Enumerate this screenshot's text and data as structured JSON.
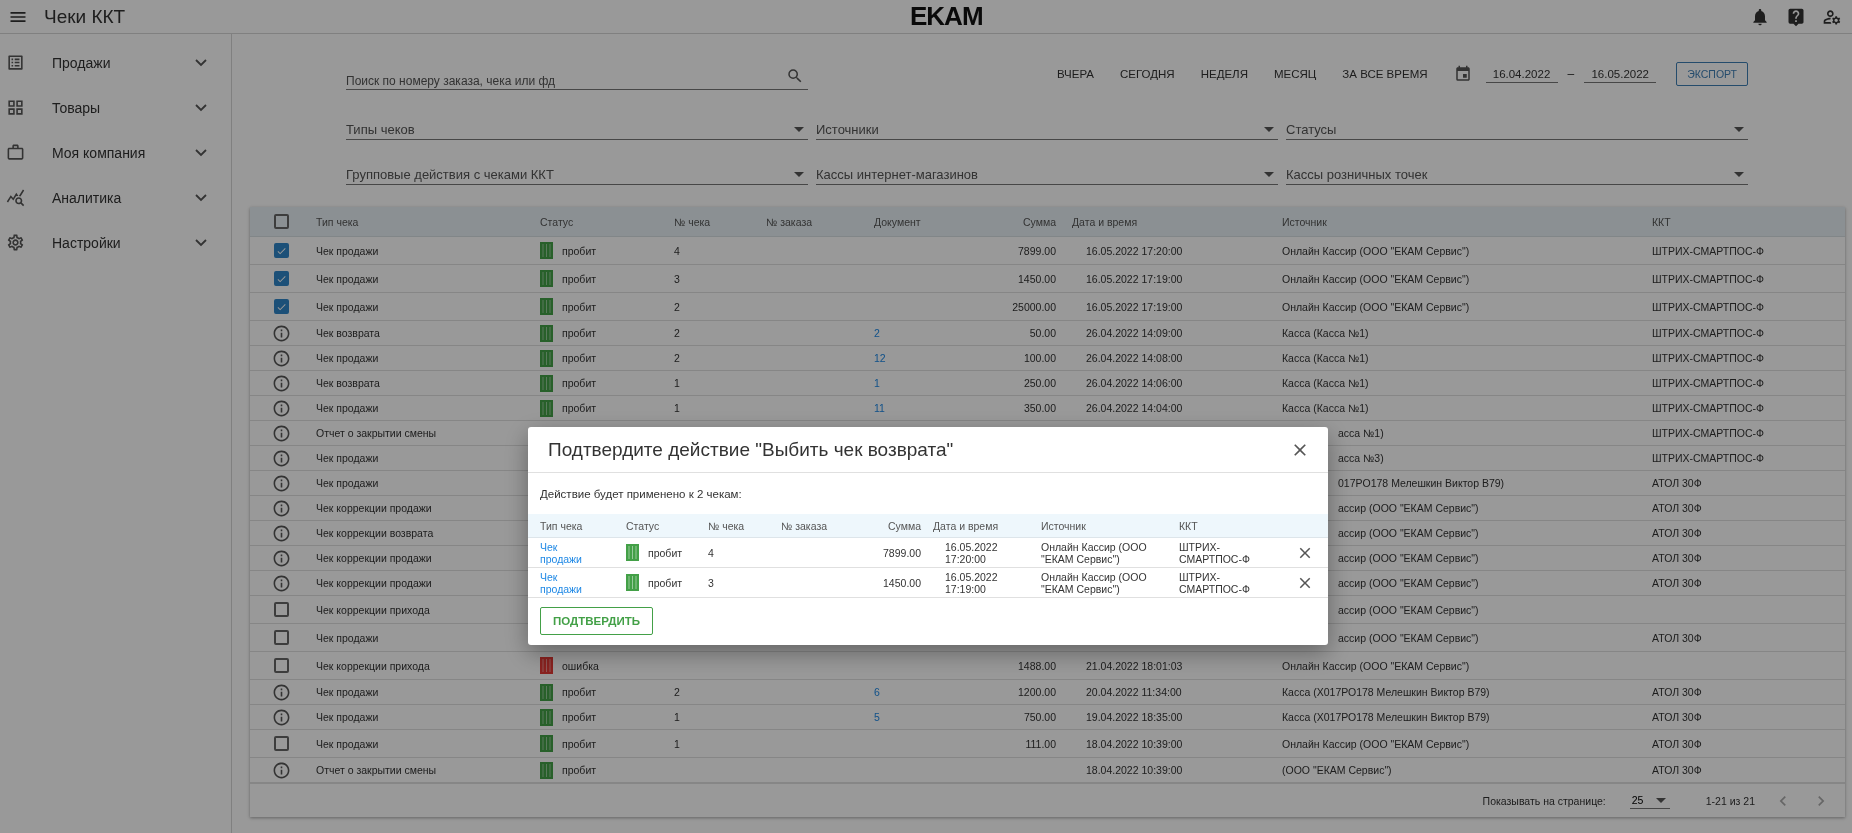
{
  "app_bar": {
    "title": "Чеки ККТ",
    "logo": "EKAM"
  },
  "sidebar": {
    "items": [
      {
        "label": "Продажи",
        "expanded": false
      },
      {
        "label": "Товары",
        "expanded": false
      },
      {
        "label": "Моя компания",
        "expanded": false
      },
      {
        "label": "Аналитика",
        "expanded": false
      },
      {
        "label": "Настройки",
        "expanded": false
      }
    ]
  },
  "search": {
    "placeholder": "Поиск по номеру заказа, чека или фд"
  },
  "periods": [
    "ВЧЕРА",
    "СЕГОДНЯ",
    "НЕДЕЛЯ",
    "МЕСЯЦ",
    "ЗА ВСЕ ВРЕМЯ"
  ],
  "date_range": {
    "from": "16.04.2022",
    "separator": "–",
    "to": "16.05.2022"
  },
  "export_button": "ЭКСПОРТ",
  "filters": [
    {
      "placeholder": "Типы чеков"
    },
    {
      "placeholder": "Источники"
    },
    {
      "placeholder": "Статусы"
    },
    {
      "placeholder": "Групповые действия с чеками ККТ"
    },
    {
      "placeholder": "Кассы интернет-магазинов"
    },
    {
      "placeholder": "Кассы розничных точек"
    }
  ],
  "table": {
    "header_checkbox": {
      "checked": false
    },
    "columns": [
      "Тип чека",
      "Статус",
      "№ чека",
      "№ заказа",
      "Документ",
      "Сумма",
      "Дата и время",
      "Источник",
      "ККТ"
    ],
    "rows": [
      {
        "kind": "checkbox",
        "checked": true,
        "type": "Чек продажи",
        "status": {
          "label": "пробит",
          "kind": "success"
        },
        "number": "4",
        "sum": "7899.00",
        "datetime": "16.05.2022 17:20:00",
        "source": "Онлайн Кассир (ООО \"ЕКАМ Сервис\")",
        "kkt": "ШТРИХ-СМАРТПОС-Ф"
      },
      {
        "kind": "checkbox",
        "checked": true,
        "type": "Чек продажи",
        "status": {
          "label": "пробит",
          "kind": "success"
        },
        "number": "3",
        "sum": "1450.00",
        "datetime": "16.05.2022 17:19:00",
        "source": "Онлайн Кассир (ООО \"ЕКАМ Сервис\")",
        "kkt": "ШТРИХ-СМАРТПОС-Ф"
      },
      {
        "kind": "checkbox",
        "checked": true,
        "type": "Чек продажи",
        "status": {
          "label": "пробит",
          "kind": "success"
        },
        "number": "2",
        "sum": "25000.00",
        "datetime": "16.05.2022 17:19:00",
        "source": "Онлайн Кассир (ООО \"ЕКАМ Сервис\")",
        "kkt": "ШТРИХ-СМАРТПОС-Ф"
      },
      {
        "kind": "info",
        "type": "Чек возврата",
        "status": {
          "label": "пробит",
          "kind": "success"
        },
        "number": "2",
        "document": "2",
        "sum": "50.00",
        "datetime": "26.04.2022 14:09:00",
        "source": "Касса (Касса №1)",
        "kkt": "ШТРИХ-СМАРТПОС-Ф"
      },
      {
        "kind": "info",
        "type": "Чек продажи",
        "status": {
          "label": "пробит",
          "kind": "success"
        },
        "number": "2",
        "document": "12",
        "sum": "100.00",
        "datetime": "26.04.2022 14:08:00",
        "source": "Касса (Касса №1)",
        "kkt": "ШТРИХ-СМАРТПОС-Ф"
      },
      {
        "kind": "info",
        "type": "Чек возврата",
        "status": {
          "label": "пробит",
          "kind": "success"
        },
        "number": "1",
        "document": "1",
        "sum": "250.00",
        "datetime": "26.04.2022 14:06:00",
        "source": "Касса (Касса №1)",
        "kkt": "ШТРИХ-СМАРТПОС-Ф"
      },
      {
        "kind": "info",
        "type": "Чек продажи",
        "status": {
          "label": "пробит",
          "kind": "success"
        },
        "number": "1",
        "document": "11",
        "sum": "350.00",
        "datetime": "26.04.2022 14:04:00",
        "source": "Касса (Касса №1)",
        "kkt": "ШТРИХ-СМАРТПОС-Ф"
      },
      {
        "kind": "info",
        "type": "Отчет о закрытии смены",
        "source": "асса №1)",
        "kkt": "ШТРИХ-СМАРТПОС-Ф"
      },
      {
        "kind": "info",
        "type": "Чек продажи",
        "source": "асса №3)",
        "kkt": "ШТРИХ-СМАРТПОС-Ф"
      },
      {
        "kind": "info",
        "type": "Чек продажи",
        "source": "017PO178 Мелешкин Виктор B79)",
        "kkt": "АТОЛ 30Ф"
      },
      {
        "kind": "info",
        "type": "Чек коррекции продажи",
        "source": "ассир (ООО \"ЕКАМ Сервис\")",
        "kkt": "АТОЛ 30Ф"
      },
      {
        "kind": "info",
        "type": "Чек коррекции возврата",
        "source": "ассир (ООО \"ЕКАМ Сервис\")",
        "kkt": "АТОЛ 30Ф"
      },
      {
        "kind": "info",
        "type": "Чек коррекции продажи",
        "source": "ассир (ООО \"ЕКАМ Сервис\")",
        "kkt": "АТОЛ 30Ф"
      },
      {
        "kind": "info",
        "type": "Чек коррекции продажи",
        "source": "ассир (ООО \"ЕКАМ Сервис\")",
        "kkt": "АТОЛ 30Ф"
      },
      {
        "kind": "checkbox",
        "checked": false,
        "type": "Чек коррекции прихода",
        "source": "ассир (ООО \"ЕКАМ Сервис\")"
      },
      {
        "kind": "checkbox",
        "checked": false,
        "type": "Чек продажи",
        "source": "ассир (ООО \"ЕКАМ Сервис\")",
        "kkt": "АТОЛ 30Ф"
      },
      {
        "kind": "checkbox",
        "checked": false,
        "type": "Чек коррекции прихода",
        "status": {
          "label": "ошибка",
          "kind": "error"
        },
        "sum": "1488.00",
        "datetime": "21.04.2022 18:01:03",
        "source": "Онлайн Кассир (ООО \"ЕКАМ Сервис\")"
      },
      {
        "kind": "info",
        "type": "Чек продажи",
        "status": {
          "label": "пробит",
          "kind": "success"
        },
        "number": "2",
        "document": "6",
        "sum": "1200.00",
        "datetime": "20.04.2022 11:34:00",
        "source": "Касса (Х017РО178 Мелешкин Виктор В79)",
        "kkt": "АТОЛ 30Ф"
      },
      {
        "kind": "info",
        "type": "Чек продажи",
        "status": {
          "label": "пробит",
          "kind": "success"
        },
        "number": "1",
        "document": "5",
        "sum": "750.00",
        "datetime": "19.04.2022 18:35:00",
        "source": "Касса (Х017РО178 Мелешкин Виктор В79)",
        "kkt": "АТОЛ 30Ф"
      },
      {
        "kind": "checkbox",
        "checked": false,
        "type": "Чек продажи",
        "status": {
          "label": "пробит",
          "kind": "success"
        },
        "number": "1",
        "sum": "111.00",
        "datetime": "18.04.2022 10:39:00",
        "source": "Онлайн Кассир (ООО \"ЕКАМ Сервис\")",
        "kkt": "АТОЛ 30Ф"
      },
      {
        "kind": "info",
        "type": "Отчет о закрытии смены",
        "status": {
          "label": "пробит",
          "kind": "success"
        },
        "datetime": "18.04.2022 10:39:00",
        "source": "(ООО \"ЕКАМ Сервис\")",
        "kkt": "АТОЛ 30Ф"
      }
    ],
    "pagination": {
      "label": "Показывать на странице:",
      "page_size": "25",
      "range": "1-21 из 21"
    }
  },
  "dialog": {
    "title": "Подтвердите действие \"Выбить чек возврата\"",
    "message": "Действие будет применено к 2 чекам:",
    "columns": [
      "Тип чека",
      "Статус",
      "№ чека",
      "№ заказа",
      "Сумма",
      "Дата и время",
      "Источник",
      "ККТ"
    ],
    "rows": [
      {
        "type": "Чек продажи",
        "status": {
          "label": "пробит",
          "kind": "success"
        },
        "number": "4",
        "sum": "7899.00",
        "datetime": "16.05.2022 17:20:00",
        "source": "Онлайн Кассир (ООО \"ЕКАМ Сервис\")",
        "kkt": "ШТРИХ-СМАРТПОС-Ф"
      },
      {
        "type": "Чек продажи",
        "status": {
          "label": "пробит",
          "kind": "success"
        },
        "number": "3",
        "sum": "1450.00",
        "datetime": "16.05.2022 17:19:00",
        "source": "Онлайн Кассир (ООО \"ЕКАМ Сервис\")",
        "kkt": "ШТРИХ-СМАРТПОС-Ф"
      }
    ],
    "confirm_button": "ПОДТВЕРДИТЬ"
  }
}
